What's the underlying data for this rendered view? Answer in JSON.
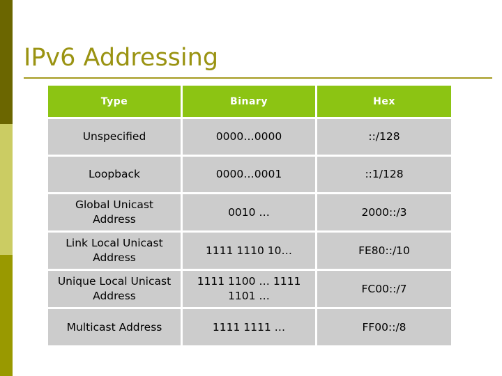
{
  "slide": {
    "title": "IPv6 Addressing"
  },
  "theme": {
    "accent_green": "#8cc413",
    "title_olive": "#9a9312",
    "rule_olive": "#a49a1e",
    "cell_gray": "#cccccc",
    "band_top": "#6b6600",
    "band_mid": "#cbcc63",
    "band_bottom": "#999900"
  },
  "sidebar": {
    "bands": [
      {
        "name": "band-top",
        "color": "#6b6600"
      },
      {
        "name": "band-mid",
        "color": "#cbcc63"
      },
      {
        "name": "band-bottom",
        "color": "#999900"
      }
    ]
  },
  "table": {
    "headers": [
      "Type",
      "Binary",
      "Hex"
    ],
    "rows": [
      {
        "type": "Unspecified",
        "binary": "0000…0000",
        "hex": "::/128"
      },
      {
        "type": "Loopback",
        "binary": "0000…0001",
        "hex": "::1/128"
      },
      {
        "type": "Global Unicast Address",
        "binary": "0010 …",
        "hex": "2000::/3"
      },
      {
        "type": "Link Local Unicast Address",
        "binary": "1111 1110 10…",
        "hex": "FE80::/10"
      },
      {
        "type": "Unique Local Unicast Address",
        "binary": "1111 1100 … 1111 1101 …",
        "hex": "FC00::/7"
      },
      {
        "type": "Multicast Address",
        "binary": "1111 1111 …",
        "hex": "FF00::/8"
      }
    ]
  }
}
